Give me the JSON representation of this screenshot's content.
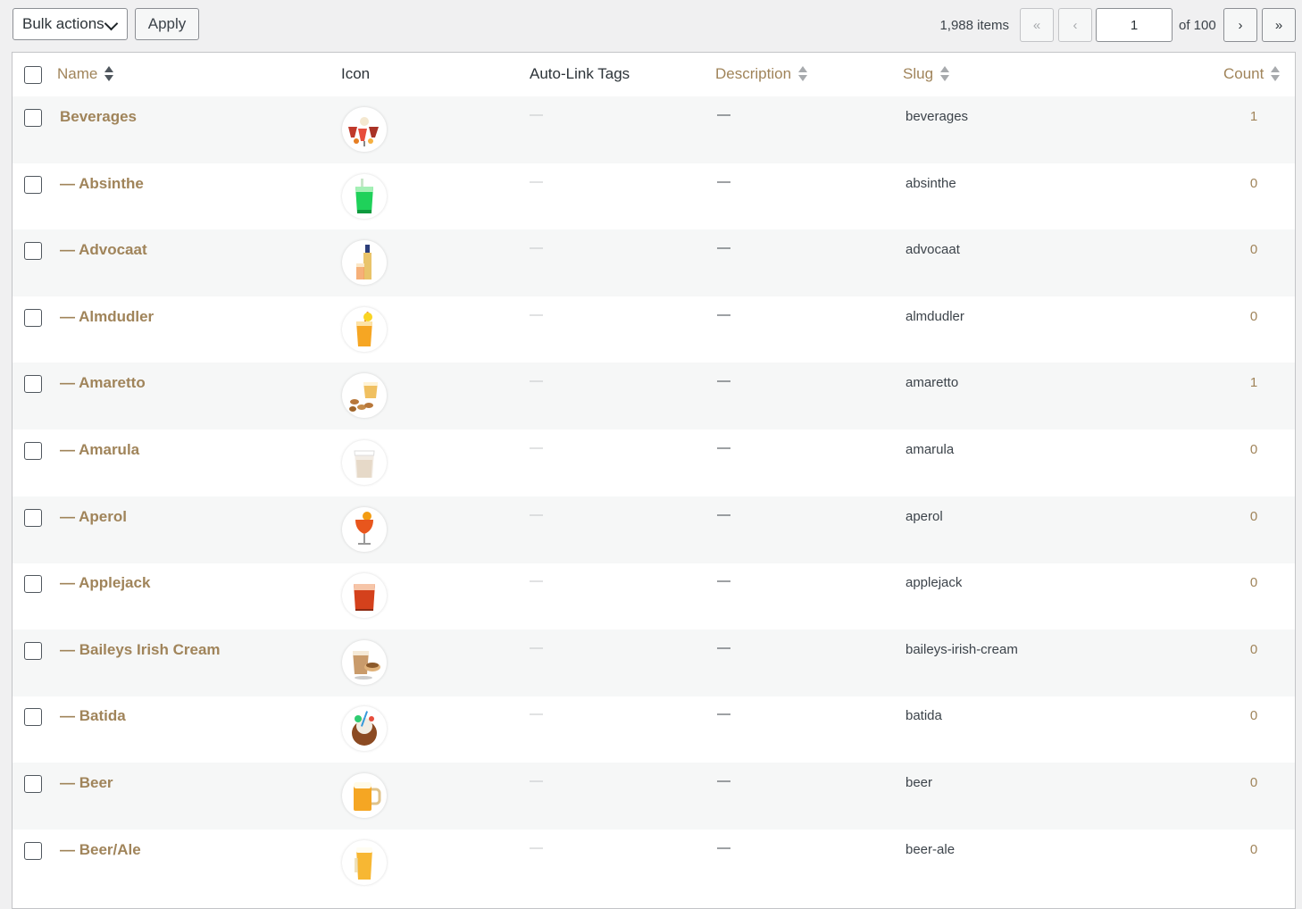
{
  "nav": {
    "bulk_label": "Bulk actions",
    "apply_label": "Apply",
    "items_count": "1,988 items",
    "first_label": "«",
    "prev_label": "‹",
    "current_page": "1",
    "of_total": "of 100",
    "next_label": "›",
    "last_label": "»"
  },
  "headers": {
    "name": "Name",
    "icon": "Icon",
    "autolink": "Auto-Link Tags",
    "description": "Description",
    "slug": "Slug",
    "count": "Count"
  },
  "colors": {
    "accent": "#a0845a",
    "border": "#c3c4c7",
    "alt_row": "#f6f7f7"
  },
  "rows": [
    {
      "name": "Beverages",
      "slug": "beverages",
      "count": "1",
      "autolink": "—",
      "description": "—",
      "icon": "cocktails-icon"
    },
    {
      "name": "— Absinthe",
      "slug": "absinthe",
      "count": "0",
      "autolink": "—",
      "description": "—",
      "icon": "green-drink-icon"
    },
    {
      "name": "— Advocaat",
      "slug": "advocaat",
      "count": "0",
      "autolink": "—",
      "description": "—",
      "icon": "bottle-glass-icon"
    },
    {
      "name": "— Almdudler",
      "slug": "almdudler",
      "count": "0",
      "autolink": "—",
      "description": "—",
      "icon": "lemonade-icon"
    },
    {
      "name": "— Amaretto",
      "slug": "amaretto",
      "count": "1",
      "autolink": "—",
      "description": "—",
      "icon": "amaretto-icon"
    },
    {
      "name": "— Amarula",
      "slug": "amarula",
      "count": "0",
      "autolink": "—",
      "description": "—",
      "icon": "cream-glass-icon"
    },
    {
      "name": "— Aperol",
      "slug": "aperol",
      "count": "0",
      "autolink": "—",
      "description": "—",
      "icon": "spritz-icon"
    },
    {
      "name": "— Applejack",
      "slug": "applejack",
      "count": "0",
      "autolink": "—",
      "description": "—",
      "icon": "red-tumbler-icon"
    },
    {
      "name": "— Baileys Irish Cream",
      "slug": "baileys-irish-cream",
      "count": "0",
      "autolink": "—",
      "description": "—",
      "icon": "irish-cream-icon"
    },
    {
      "name": "— Batida",
      "slug": "batida",
      "count": "0",
      "autolink": "—",
      "description": "—",
      "icon": "coconut-drink-icon"
    },
    {
      "name": "— Beer",
      "slug": "beer",
      "count": "0",
      "autolink": "—",
      "description": "—",
      "icon": "beer-mug-icon"
    },
    {
      "name": "— Beer/Ale",
      "slug": "beer-ale",
      "count": "0",
      "autolink": "—",
      "description": "—",
      "icon": "beer-glass-icon"
    }
  ]
}
